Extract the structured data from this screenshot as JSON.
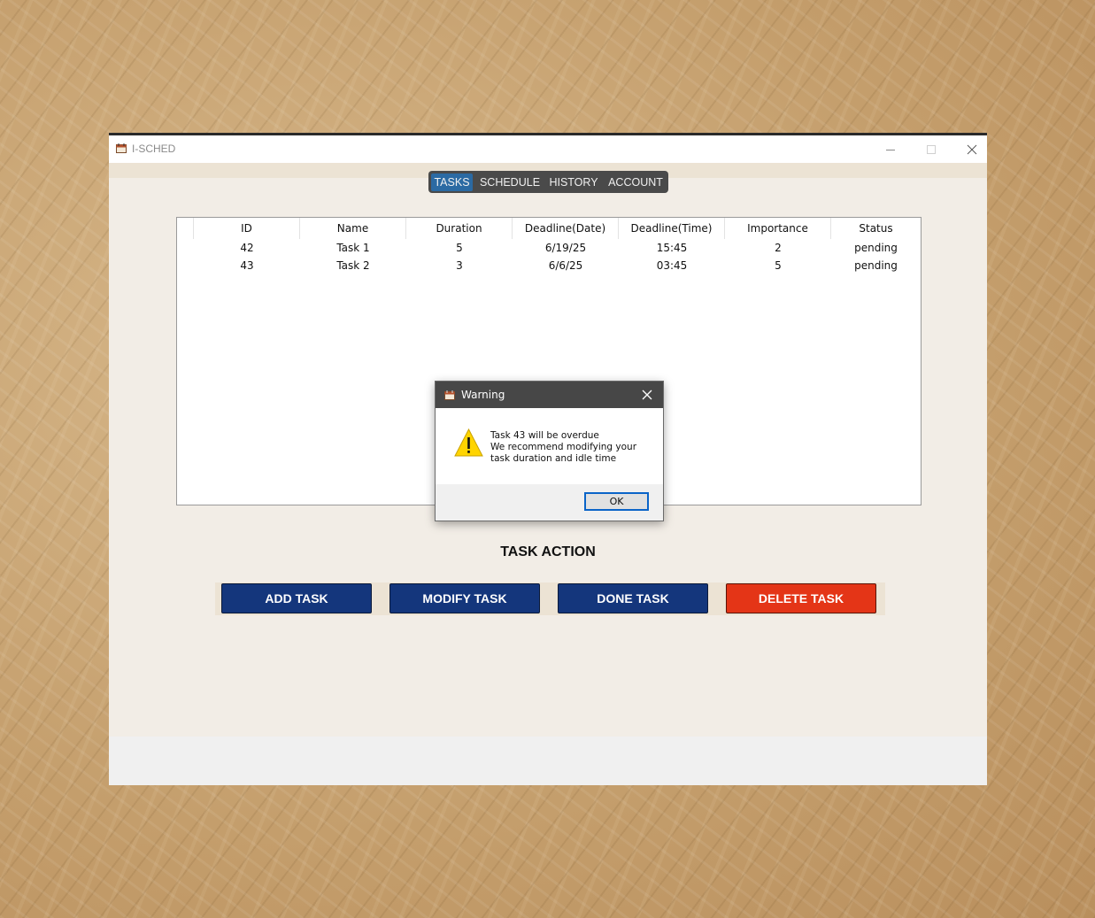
{
  "window": {
    "title": "I-SCHED"
  },
  "nav": {
    "tabs": [
      {
        "label": "TASKS",
        "active": true
      },
      {
        "label": "SCHEDULE",
        "active": false
      },
      {
        "label": "HISTORY",
        "active": false
      },
      {
        "label": "ACCOUNT",
        "active": false
      }
    ]
  },
  "table": {
    "columns": [
      "ID",
      "Name",
      "Duration",
      "Deadline(Date)",
      "Deadline(Time)",
      "Importance",
      "Status"
    ],
    "rows": [
      [
        "42",
        "Task 1",
        "5",
        "6/19/25",
        "15:45",
        "2",
        "pending"
      ],
      [
        "43",
        "Task 2",
        "3",
        "6/6/25",
        "03:45",
        "5",
        "pending"
      ]
    ]
  },
  "actions": {
    "title": "TASK ACTION",
    "add": "ADD TASK",
    "modify": "MODIFY TASK",
    "done": "DONE TASK",
    "delete": "DELETE TASK"
  },
  "dialog": {
    "title": "Warning",
    "lines": [
      "Task 43 will be overdue",
      "We recommend modifying your",
      "task duration and idle time"
    ],
    "ok_label": "OK"
  },
  "colors": {
    "primary_button": "#14367c",
    "danger_button": "#e43517",
    "nav_active": "#2b6aa3",
    "nav_bg": "#4a4a4a",
    "warning_icon": "#ffd400"
  },
  "icons": {
    "app": "calendar-icon",
    "minimize": "minimize-icon",
    "maximize": "maximize-icon",
    "close": "close-icon",
    "warning": "warning-triangle-icon"
  }
}
